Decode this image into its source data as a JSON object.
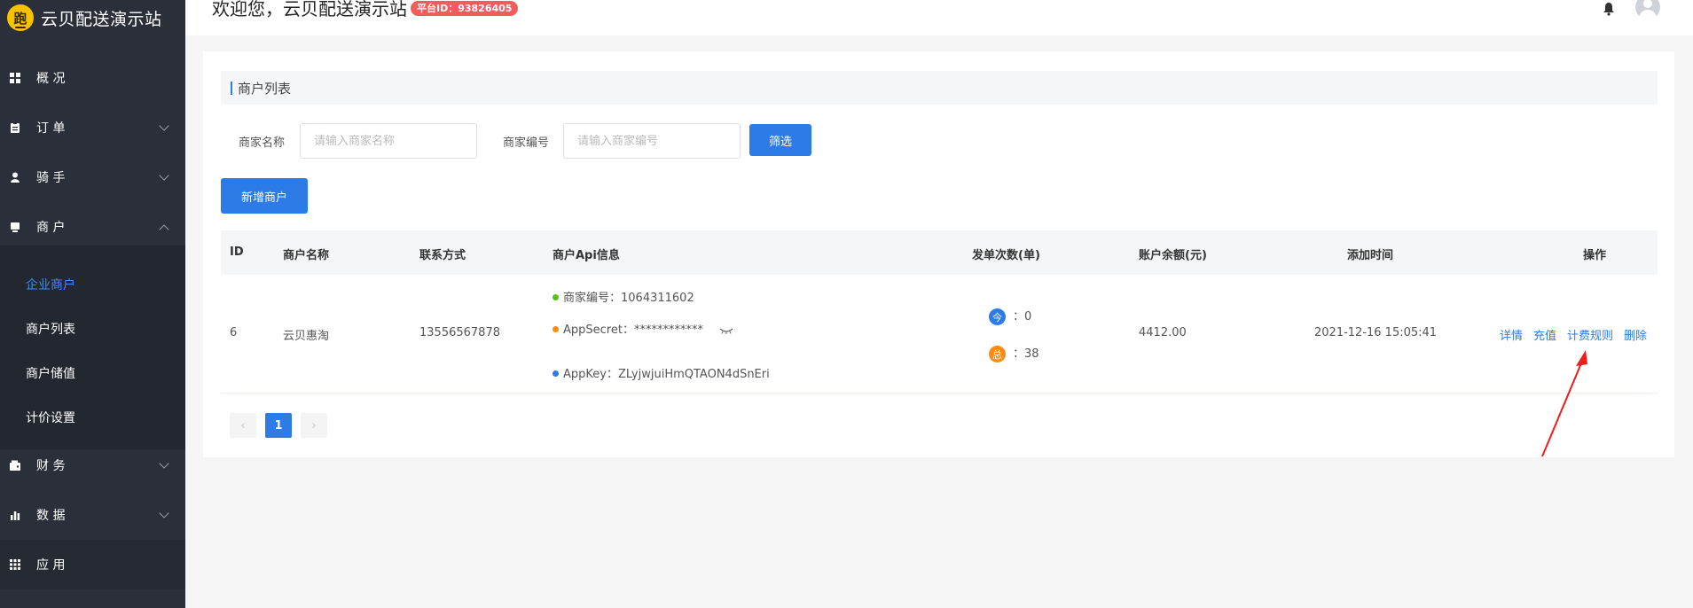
{
  "brand": {
    "title": "云贝配送演示站",
    "logo_glyph": "跑"
  },
  "header": {
    "welcome": "欢迎您，云贝配送演示站",
    "platform_badge": "平台ID：93826405"
  },
  "sidebar": {
    "items": [
      {
        "label": "概 况"
      },
      {
        "label": "订 单"
      },
      {
        "label": "骑 手"
      },
      {
        "label": "商 户"
      },
      {
        "label": "财 务"
      },
      {
        "label": "数 据"
      },
      {
        "label": "应 用"
      }
    ],
    "merchant_sub": [
      {
        "label": "企业商户"
      },
      {
        "label": "商户列表"
      },
      {
        "label": "商户储值"
      },
      {
        "label": "计价设置"
      }
    ]
  },
  "page": {
    "section_title": "商户列表",
    "filter": {
      "name_label": "商家名称",
      "name_placeholder": "请输入商家名称",
      "code_label": "商家编号",
      "code_placeholder": "请输入商家编号",
      "filter_button": "筛选"
    },
    "add_button": "新增商户",
    "table": {
      "columns": [
        "ID",
        "商户名称",
        "联系方式",
        "商户Api信息",
        "发单次数(单)",
        "账户余额(元)",
        "添加时间",
        "操作"
      ],
      "row": {
        "id": "6",
        "name": "云贝惠淘",
        "contact": "13556567878",
        "api_code": "商家编号：1064311602",
        "api_secret": "AppSecret：************",
        "api_key": "AppKey：ZLyjwjuiHmQTAON4dSnEri",
        "today_badge": "今",
        "today_count": "：0",
        "total_badge": "总",
        "total_count": "：38",
        "balance": "4412.00",
        "added": "2021-12-16 15:05:41",
        "actions": [
          "详情",
          "充值",
          "计费规则",
          "删除"
        ]
      }
    },
    "pagination": {
      "prev": "‹",
      "current": "1",
      "next": "›"
    }
  },
  "colors": {
    "primary": "#2d7be6",
    "sidebar_bg": "#2b2f3a",
    "badge_red": "#f25c5c",
    "green_dot": "#52c41a",
    "orange_dot": "#fa8c16",
    "blue_dot": "#2d7be6"
  }
}
